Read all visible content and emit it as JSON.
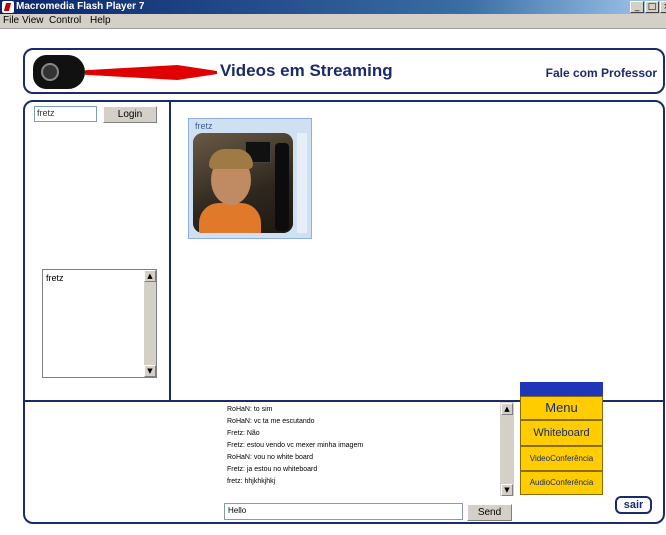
{
  "window": {
    "title": "Macromedia Flash Player 7",
    "controls": {
      "minimize": "_",
      "maximize": "□",
      "close": "×"
    }
  },
  "menubar": {
    "items": [
      "File",
      "View",
      "Control",
      "Help"
    ]
  },
  "header": {
    "title": "Videos em Streaming",
    "contact_link": "Fale com Professor"
  },
  "login": {
    "username_value": "fretz",
    "button_label": "Login"
  },
  "users": {
    "items": [
      "fretz"
    ]
  },
  "video": {
    "user_label": "fretz"
  },
  "chat": {
    "messages": [
      "RoHaN: to sim",
      "RoHaN: vc ta me escutando",
      "Fretz: Não",
      "Fretz: estou vendo vc mexer minha imagem",
      "RoHaN: vou no white board",
      "Fretz: ja estou no whiteboard",
      "fretz: hhjkhkjhkj"
    ],
    "input_value": "Hello",
    "send_label": "Send"
  },
  "side_menu": {
    "title": "Menu",
    "items": [
      "Whiteboard",
      "VideoConferência",
      "AudioConferência"
    ]
  },
  "exit_label": "sair",
  "colors": {
    "navy": "#1a2a6a",
    "menu_yellow": "#ffcc00",
    "menu_blue": "#1f36b8",
    "logo_red": "#e00000"
  }
}
